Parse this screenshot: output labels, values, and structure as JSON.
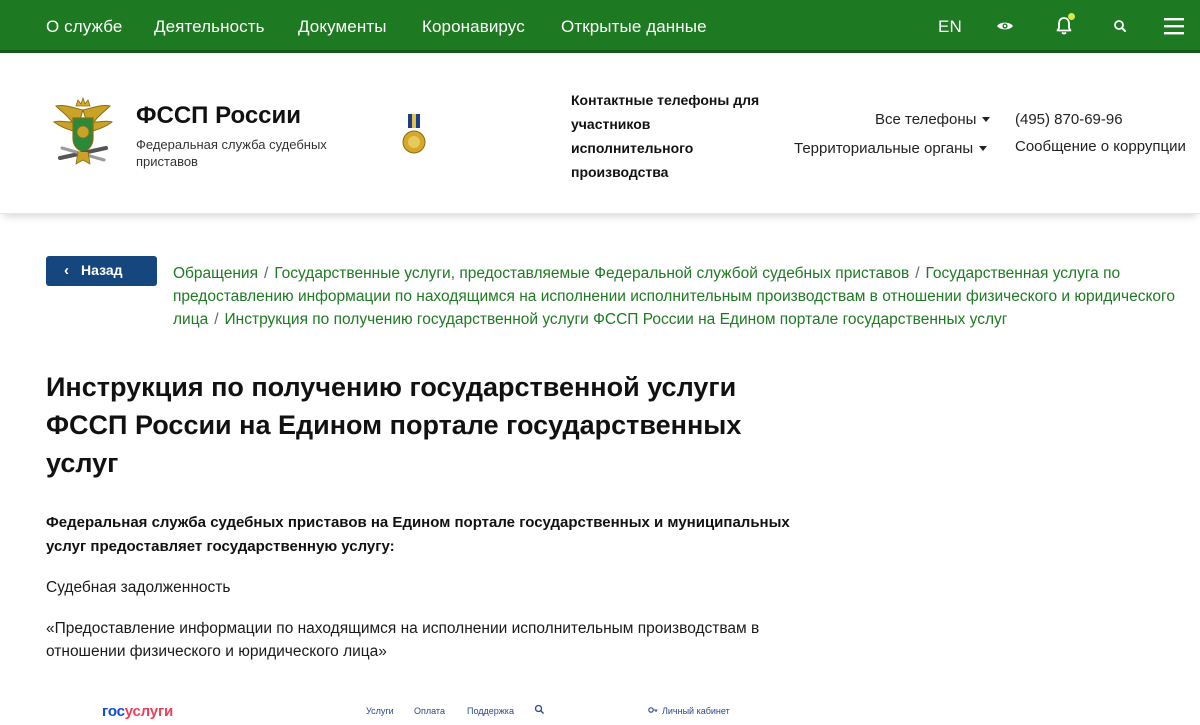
{
  "topnav": {
    "items": [
      "О службе",
      "Деятельность",
      "Документы",
      "Коронавирус",
      "Открытые данные"
    ],
    "lang": "EN",
    "colors": {
      "bar": "#1e7a22",
      "indicator": "#d8e84a"
    }
  },
  "header": {
    "title": "ФССП России",
    "subtitle": "Федеральная служба судебных приставов",
    "contacts_heading": "Контактные телефоны для участников исполнительного производства",
    "all_phones": "Все телефоны",
    "phone": "(495) 870-69-96",
    "territorial": "Территориальные органы",
    "corruption": "Сообщение о коррупции"
  },
  "breadcrumb": {
    "back_label": "Назад",
    "items": [
      "Обращения",
      "Государственные услуги, предоставляемые Федеральной службой судебных приставов",
      "Государственная услуга по предоставлению информации по находящимся на исполнении исполнительным производствам в отношении физического и юридического лица",
      "Инструкция по получению государственной услуги ФССП России на Едином портале государственных услуг"
    ],
    "colors": {
      "link": "#1e7a22",
      "back_button": "#15467d"
    }
  },
  "content": {
    "title": "Инструкция по получению государственной услуги ФССП России на Едином портале государственных услуг",
    "lead": "Федеральная служба судебных приставов на Едином портале государственных и муниципальных услуг предоставляет государственную услугу:",
    "service_name": "Судебная задолженность",
    "service_quote_line1": "«Предоставление информации по находящимся на исполнении исполнительным производствам в",
    "service_quote_line2": "отношении физического и юридического лица»"
  },
  "gosuslugi": {
    "logo_part1": "гос",
    "logo_part2": "услуги",
    "nav": [
      "Услуги",
      "Оплата",
      "Поддержка"
    ],
    "cabinet": "Личный кабинет",
    "colors": {
      "blue": "#0d4cd3",
      "red": "#ee3f58"
    }
  }
}
